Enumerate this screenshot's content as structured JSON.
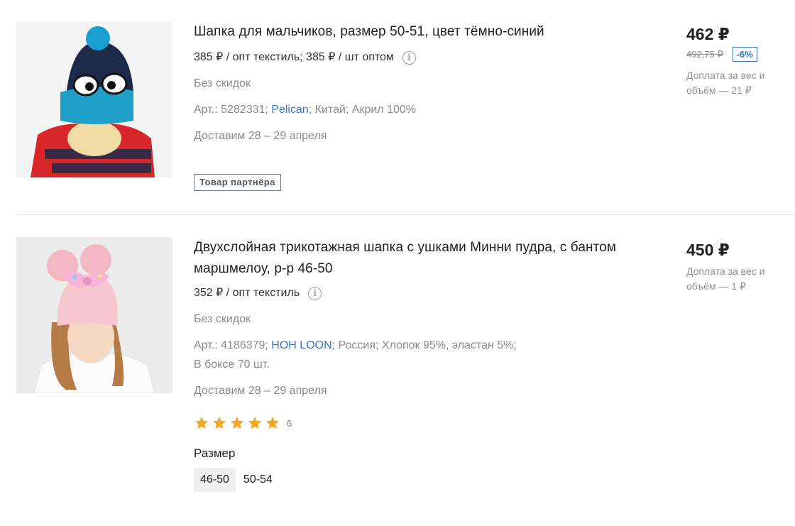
{
  "products": [
    {
      "title": "Шапка для мальчиков, размер 50-51, цвет тёмно-синий",
      "wholesale": "385 ₽ / опт текстиль; 385 ₽ / шт оптом",
      "discount_note": "Без скидок",
      "article_prefix": "Арт.: 5282331; ",
      "brand": "Pelican",
      "article_suffix": "; Китай; Акрил 100%",
      "delivery": "Доставим 28 – 29 апреля",
      "partner_badge": "Товар партнёра",
      "price": "462 ₽",
      "old_price": "492,75 ₽",
      "discount": "-6%",
      "surcharge": "Доплата за вес и объём — 21 ₽",
      "image_icon": "kids-hat-photo"
    },
    {
      "title": "Двухслойная трикотажная шапка с ушками Минни пудра, с бантом маршмелоу, р-р 46-50",
      "wholesale": "352 ₽ / опт текстиль",
      "discount_note": "Без скидок",
      "article_prefix": "Арт.: 4186379; ",
      "brand": "HOH LOON",
      "article_suffix": "; Россия; Хлопок 95%, эластан 5%;",
      "box": "В боксе 70 шт.",
      "delivery": "Доставим 28 – 29 апреля",
      "rating": 5,
      "rating_count": "6",
      "size_label": "Размер",
      "sizes": [
        "46-50",
        "50-54"
      ],
      "selected_size": "46-50",
      "price": "450 ₽",
      "surcharge": "Доплата за вес и объём — 1 ₽",
      "image_icon": "minnie-hat-photo"
    }
  ],
  "colors": {
    "accent": "#3a74c8",
    "star": "#f5a623",
    "muted": "#8a8a8a"
  }
}
